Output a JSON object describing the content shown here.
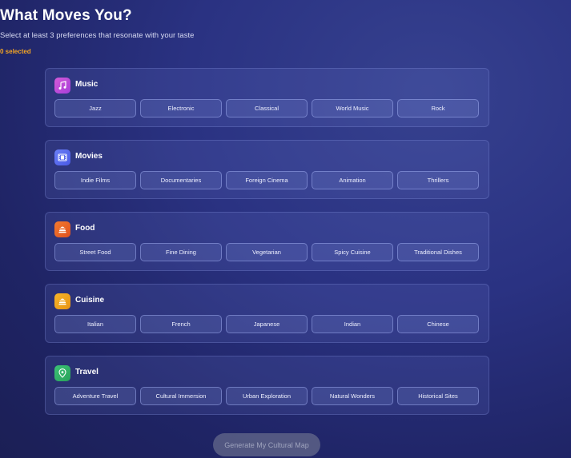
{
  "header": {
    "title": "What Moves You?",
    "subtitle": "Select at least 3 preferences that resonate with your taste",
    "selected_count": "0 selected"
  },
  "sections": [
    {
      "title": "Music",
      "icon": "music-note-icon",
      "color": "#c84fd8",
      "options": [
        "Jazz",
        "Electronic",
        "Classical",
        "World Music",
        "Rock"
      ]
    },
    {
      "title": "Movies",
      "icon": "film-icon",
      "color": "#5a6ef0",
      "options": [
        "Indie Films",
        "Documentaries",
        "Foreign Cinema",
        "Animation",
        "Thrillers"
      ]
    },
    {
      "title": "Food",
      "icon": "food-icon",
      "color": "#ee6a2a",
      "options": [
        "Street Food",
        "Fine Dining",
        "Vegetarian",
        "Spicy Cuisine",
        "Traditional Dishes"
      ]
    },
    {
      "title": "Cuisine",
      "icon": "cuisine-icon",
      "color": "#f2a51b",
      "options": [
        "Italian",
        "French",
        "Japanese",
        "Indian",
        "Chinese"
      ]
    },
    {
      "title": "Travel",
      "icon": "map-pin-icon",
      "color": "#33b56a",
      "options": [
        "Adventure Travel",
        "Cultural Immersion",
        "Urban Exploration",
        "Natural Wonders",
        "Historical Sites"
      ]
    }
  ],
  "footer": {
    "generate_label": "Generate My Cultural Map"
  }
}
